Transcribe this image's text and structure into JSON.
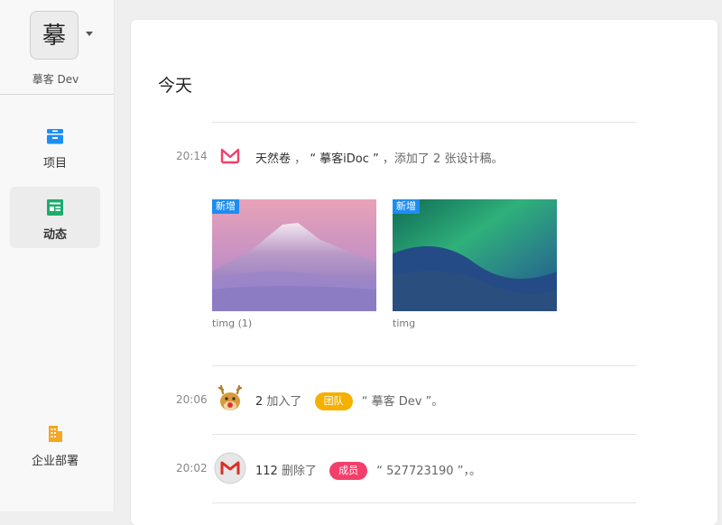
{
  "sidebar": {
    "avatar_char": "摹",
    "team_name": "摹客 Dev",
    "items": [
      {
        "label": "项目",
        "icon": "folder-icon",
        "active": false
      },
      {
        "label": "动态",
        "icon": "activity-icon",
        "active": true
      },
      {
        "label": "企业部署",
        "icon": "building-icon",
        "active": false
      }
    ]
  },
  "main": {
    "day_title": "今天",
    "activities": [
      {
        "time": "20:14",
        "icon": "mockplus-logo-icon",
        "actor": "天然卷",
        "sep": "，",
        "object": "“ 摹客iDoc ”",
        "action": "，添加了 2 张设计稿。",
        "images": [
          {
            "caption": "timg (1)",
            "badge": "新增"
          },
          {
            "caption": "timg",
            "badge": "新增"
          }
        ]
      },
      {
        "time": "20:06",
        "icon": "reindeer-avatar-icon",
        "actor": "2",
        "action": "加入了",
        "tag": "团队",
        "tag_color": "#f5b000",
        "object": "“ 摹客 Dev ”。"
      },
      {
        "time": "20:02",
        "icon": "gmail-avatar-icon",
        "actor": "112",
        "action": "删除了",
        "tag": "成员",
        "tag_color": "#f43f6a",
        "object": "“ 527723190 ”，。"
      }
    ]
  },
  "colors": {
    "accent_blue": "#1d8df4",
    "icon_green": "#1aad6e",
    "icon_orange": "#f5a623",
    "tag_yellow": "#f5b000",
    "tag_pink": "#f43f6a"
  }
}
